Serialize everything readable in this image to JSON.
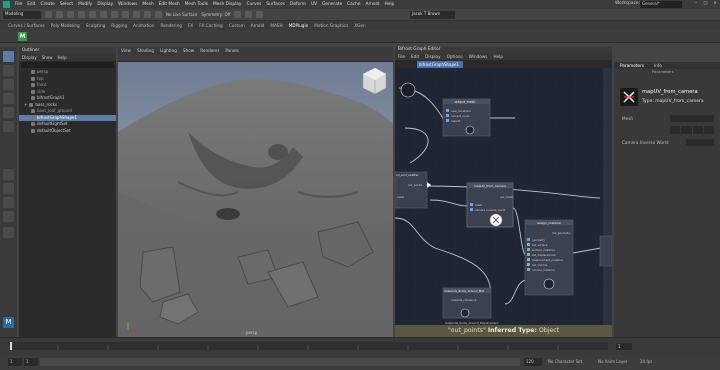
{
  "menubar": {
    "items": [
      "File",
      "Edit",
      "Create",
      "Select",
      "Modify",
      "Display",
      "Windows",
      "Mesh",
      "Edit Mesh",
      "Mesh Tools",
      "Mesh Display",
      "Curves",
      "Surfaces",
      "Deform",
      "UV",
      "Generate",
      "Cache",
      "Arnold",
      "Help"
    ],
    "workspace_label": "Workspace:",
    "workspace_value": "General*"
  },
  "statusline": {
    "mode": "Modeling",
    "surface": "No Live Surface",
    "symmetry": "Symmetry: Off",
    "user": "Jacek T Brown"
  },
  "shelf": {
    "tabs": [
      "Curves / Surfaces",
      "Poly Modeling",
      "Sculpting",
      "Rigging",
      "Animation",
      "Rendering",
      "FX",
      "FX Caching",
      "Custom",
      "Arnold",
      "MASH",
      "MDPlugin",
      "Motion Graphics",
      "XGen"
    ],
    "active_tab": "MDPlugin",
    "mash_icon": "M"
  },
  "outliner": {
    "title": "Outliner",
    "menu": [
      "Display",
      "Show",
      "Help"
    ],
    "items": [
      {
        "label": "persp",
        "indent": 1,
        "selected": false
      },
      {
        "label": "top",
        "indent": 1,
        "selected": false
      },
      {
        "label": "front",
        "indent": 1,
        "selected": false
      },
      {
        "label": "side",
        "indent": 1,
        "selected": false
      },
      {
        "label": "bifrostGraph1",
        "indent": 1,
        "selected": false
      },
      {
        "label": "bass_rocks",
        "indent": 0,
        "selected": false
      },
      {
        "label": "bass_leaf_ground",
        "indent": 1,
        "selected": false
      },
      {
        "label": "bifrostGraphShape1",
        "indent": 1,
        "selected": true
      },
      {
        "label": "defaultLightSet",
        "indent": 1,
        "selected": false
      },
      {
        "label": "defaultObjectSet",
        "indent": 1,
        "selected": false
      }
    ]
  },
  "viewport": {
    "menu": [
      "View",
      "Shading",
      "Lighting",
      "Show",
      "Renderer",
      "Panels"
    ],
    "camera_label": "persp"
  },
  "graph_editor": {
    "title": "Bifrost Graph Editor",
    "menu": [
      "File",
      "Edit",
      "Display",
      "Options",
      "Windows",
      "Help"
    ],
    "tab_label": "bifrostGraphShape1",
    "footer_port": "\"out_points\"",
    "footer_type_label": "Inferred Type:",
    "footer_type_value": "Object",
    "nodes": [
      {
        "title": "output_mesh",
        "ports": [
          "new_locations",
          "current_node",
          "result1"
        ]
      },
      {
        "title": "mapUV_from_camera",
        "ports": [
          "out_mesh",
          "mesh",
          "camera_inverse_world"
        ]
      },
      {
        "title": "assign_material",
        "ports": [
          "out_geometry",
          "geometry",
          "set_surface",
          "surface_material",
          "set_displacement",
          "displacement_material",
          "set_volume",
          "volume_material"
        ]
      },
      {
        "title": "redwoods_Rocky_Ground_Mat",
        "ports": [
          "material_reference"
        ]
      },
      {
        "title": "redwoods_Rocky_Ground_Displacement",
        "ports": []
      },
      {
        "title": "cd_and_scatter",
        "ports": [
          "out_points",
          "mesh"
        ]
      }
    ]
  },
  "attribute_panel": {
    "tabs": [
      "Parameters",
      "Info"
    ],
    "sub_label": "Parameters",
    "node_name": "mapUV_from_camera",
    "node_type": "Type: mapUV_from_camera",
    "mesh_label": "Mesh",
    "camera_label": "Camera Inverse World"
  },
  "timeline": {
    "current_frame": "1",
    "range_start": "1",
    "range_end": "120",
    "end_frame": "200",
    "character_set": "No Character Set",
    "anim_layer": "No Anim Layer",
    "fps": "24 fps"
  },
  "colors": {
    "accent": "#5d7ea6",
    "graph_bg": "#1f2533",
    "wire": "#b9c4dc",
    "footer": "#5b5742"
  }
}
